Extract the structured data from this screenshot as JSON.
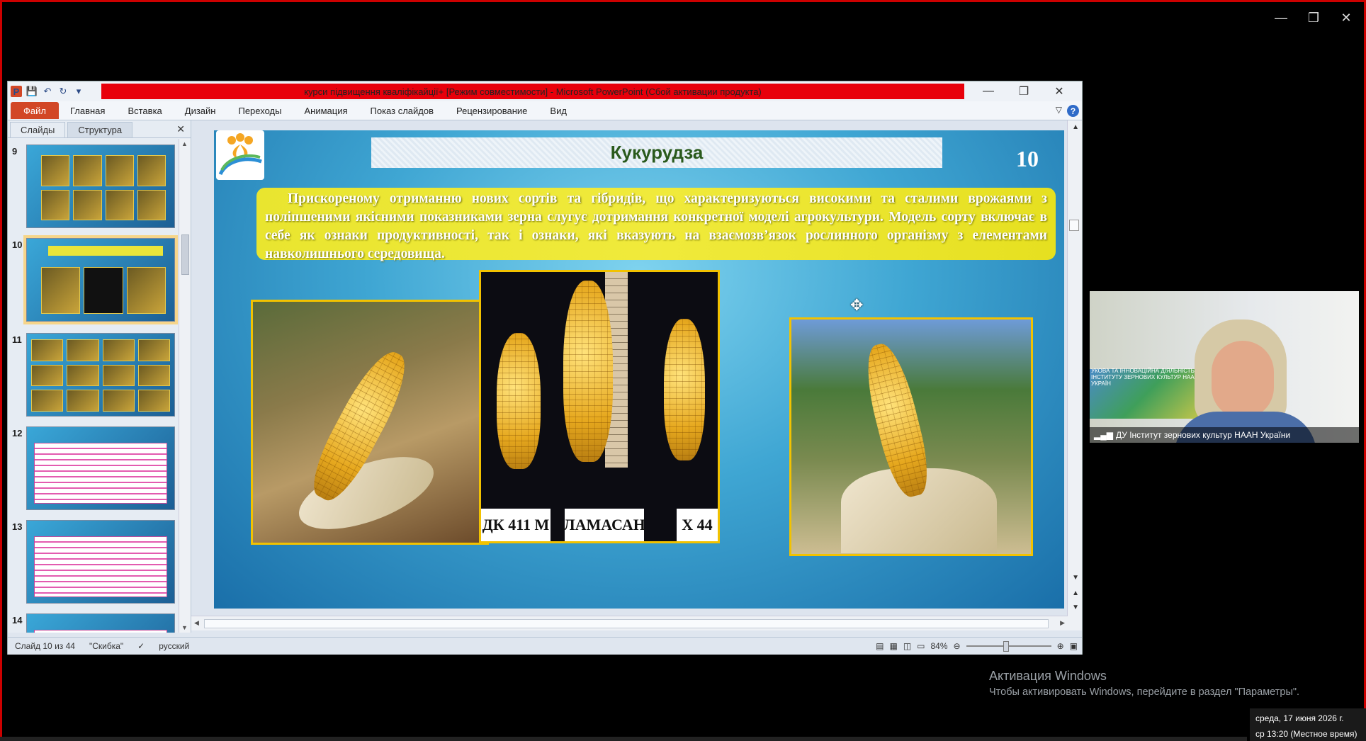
{
  "outer": {
    "controls": [
      "—",
      "❐",
      "✕"
    ]
  },
  "ppt": {
    "title": "курси підвищення кваліфікайції+ [Режим совместимости]  -  Microsoft PowerPoint (Сбой активации продукта)",
    "ribbon_tabs": [
      "Файл",
      "Главная",
      "Вставка",
      "Дизайн",
      "Переходы",
      "Анимация",
      "Показ слайдов",
      "Рецензирование",
      "Вид"
    ],
    "side_tabs": [
      "Слайды",
      "Структура"
    ],
    "thumbnails": [
      "9",
      "10",
      "11",
      "12",
      "13",
      "14"
    ],
    "slide": {
      "title": "Кукурудза",
      "number": "10",
      "text": "Прискореному отриманню нових сортів та гібридів, що характеризуються високими та сталими врожаями з поліпшеними якісними показниками зерна  слугує дотримання конкретної моделі агрокультури. Модель сорту включає в себе як ознаки продуктивності, так і ознаки, які вказують на взаємозв’язок рослинного організму з елементами навколишнього середовища.",
      "labels": [
        "ДК 411 М",
        "ЛАМАСАН",
        "Х 44"
      ]
    },
    "status": {
      "slide": "Слайд 10 из 44",
      "theme": "\"Скибка\"",
      "language": "русский",
      "zoom": "84%"
    }
  },
  "video": {
    "participant": "ДУ Інститут зернових культур НААН України",
    "wall_text": "УКОВА ТА ІННОВАЦІЙНА ДІЯЛЬНІСТЬ ІНСТИТУТУ ЗЕРНОВИХ КУЛЬТУР НААН УКРАЇН"
  },
  "activation": {
    "title": "Активация Windows",
    "text": "Чтобы активировать Windows, перейдите в раздел \"Параметры\"."
  },
  "clock": {
    "date": "среда, 17 июня 2026 г.",
    "time": "ср 13:20 (Местное время)"
  }
}
